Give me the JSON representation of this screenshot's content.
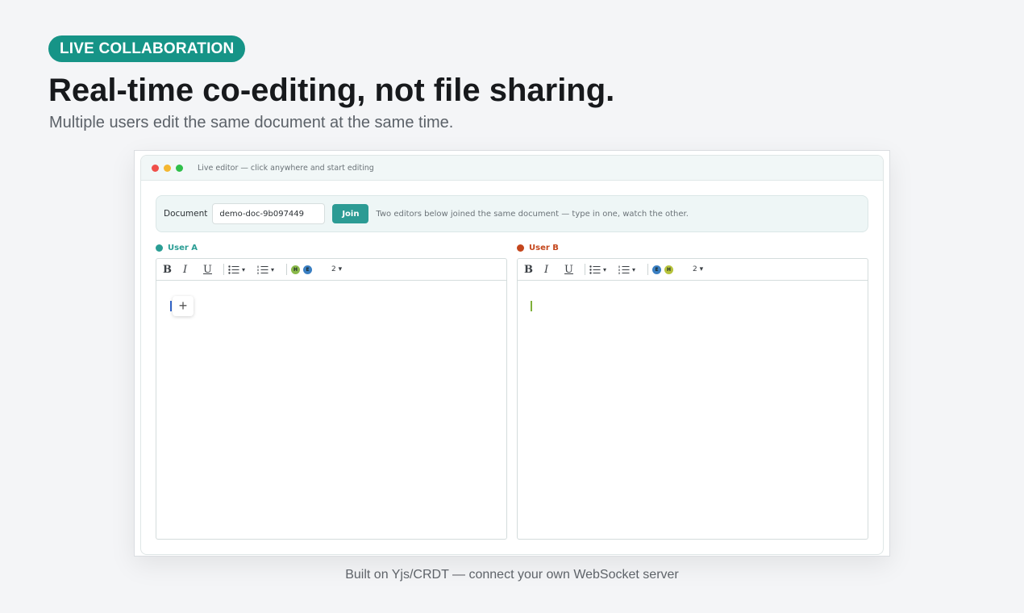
{
  "hero": {
    "badge": "LIVE COLLABORATION",
    "headline": "Real-time co-editing, not file sharing.",
    "subline": "Multiple users edit the same document at the same time."
  },
  "window": {
    "title": "Live editor — click anywhere and start editing"
  },
  "docbar": {
    "label": "Document",
    "value": "demo-doc-9b097449",
    "join_label": "Join",
    "hint": "Two editors below joined the same document — type in one, watch the other."
  },
  "editors": [
    {
      "user": "User A",
      "color": "#2a9d94",
      "cursor_color": "#3366cc",
      "toolbar": {
        "bold": "B",
        "italic": "I",
        "underline": "U",
        "highlight_1": "H",
        "highlight_2": "E",
        "size": "2 ▾",
        "dropdown": "▾"
      }
    },
    {
      "user": "User B",
      "color": "#c4461c",
      "cursor_color": "#7fb03a",
      "toolbar": {
        "bold": "B",
        "italic": "I",
        "underline": "U",
        "highlight_1": "E",
        "highlight_2": "H",
        "size": "2 ▾",
        "dropdown": "▾"
      }
    }
  ],
  "caption": "Built on Yjs/CRDT — connect your own WebSocket server"
}
